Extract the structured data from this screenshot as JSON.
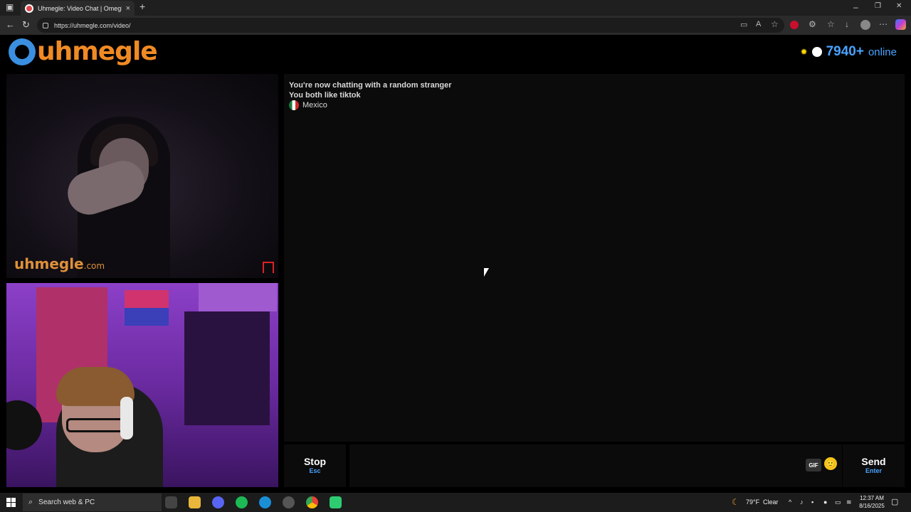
{
  "browser": {
    "tab_title": "Uhmegle: Video Chat | Omegle",
    "tab_close": "×",
    "new_tab": "+",
    "url": "https://uhmegle.com/video/",
    "window_controls": {
      "minimize": "–",
      "restore": "❐",
      "close": "✕"
    }
  },
  "site": {
    "logo_text": "uhmegle",
    "online_count": "7940+",
    "online_label": "online"
  },
  "video": {
    "watermark_main": "uhmegle",
    "watermark_suffix": ".com"
  },
  "chat": {
    "messages": [
      "You're now chatting with a random stranger",
      "You both like tiktok"
    ],
    "country": "Mexico",
    "input_placeholder": "",
    "stop_label": "Stop",
    "stop_key": "Esc",
    "gif_label": "GIF",
    "emoji": "🙂",
    "send_label": "Send",
    "send_key": "Enter"
  },
  "taskbar": {
    "search_placeholder": "Search web & PC",
    "weather_temp": "79°F",
    "weather_desc": "Clear",
    "time": "12:37 AM",
    "date": "8/16/2025"
  },
  "colors": {
    "accent_blue": "#4aa3ff",
    "logo_orange": "#f08a24",
    "chat_bg": "#0b0b0b"
  }
}
